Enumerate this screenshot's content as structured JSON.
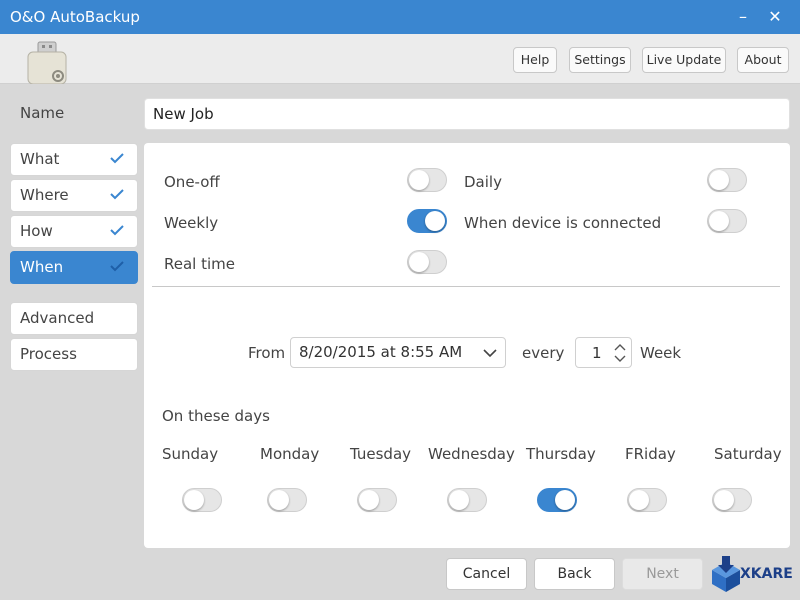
{
  "window": {
    "title": "O&O AutoBackup",
    "minimize_label": "–",
    "close_label": "✕"
  },
  "header": {
    "buttons": [
      {
        "label": "Help"
      },
      {
        "label": "Settings"
      },
      {
        "label": "Live Update"
      },
      {
        "label": "About"
      }
    ]
  },
  "name_field": {
    "label": "Name",
    "value": "New Job"
  },
  "nav": {
    "items": [
      {
        "label": "What",
        "checked": true
      },
      {
        "label": "Where",
        "checked": true
      },
      {
        "label": "How",
        "checked": true
      },
      {
        "label": "When",
        "checked": true,
        "active": true
      },
      {
        "label": "Advanced"
      },
      {
        "label": "Process"
      }
    ]
  },
  "when": {
    "options": [
      {
        "label": "One-off",
        "on": false
      },
      {
        "label": "Daily",
        "on": false
      },
      {
        "label": "Weekly",
        "on": true
      },
      {
        "label": "When device is connected",
        "on": false
      },
      {
        "label": "Real time",
        "on": false
      }
    ],
    "from_label": "From",
    "from_value": "8/20/2015 at 8:55 AM",
    "every_label": "every",
    "every_value": "1",
    "unit_label": "Week",
    "days_title": "On these days",
    "days": [
      {
        "label": "Sunday",
        "on": false
      },
      {
        "label": "Monday",
        "on": false
      },
      {
        "label": "Tuesday",
        "on": false
      },
      {
        "label": "Wednesday",
        "on": false
      },
      {
        "label": "Thursday",
        "on": true
      },
      {
        "label": "FRiday",
        "on": false
      },
      {
        "label": "Saturday",
        "on": false
      }
    ]
  },
  "footer": {
    "cancel_label": "Cancel",
    "back_label": "Back",
    "next_label": "Next",
    "watermark_text": "XKARE"
  },
  "colors": {
    "accent": "#3a86d0"
  }
}
